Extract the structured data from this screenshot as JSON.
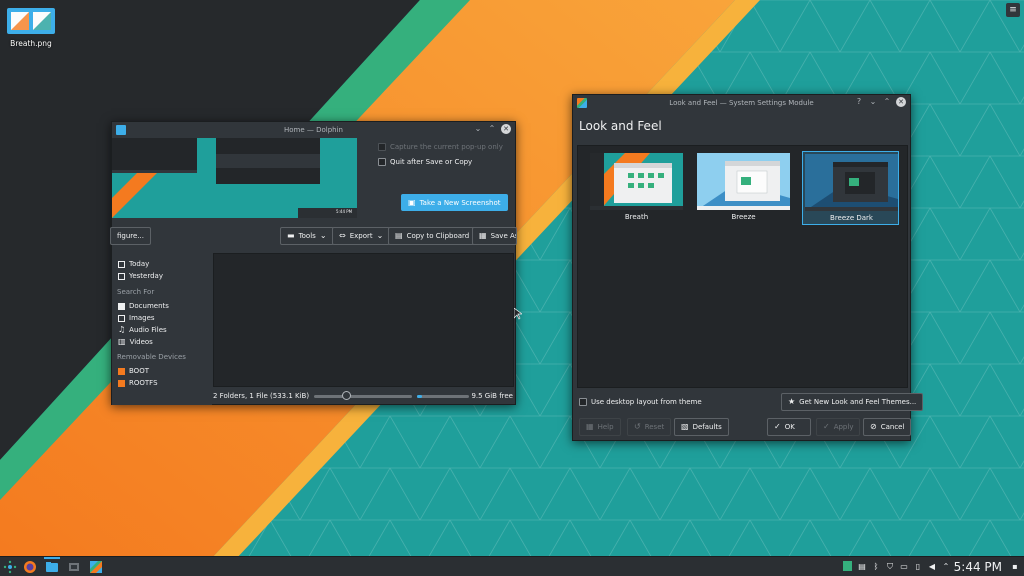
{
  "desktop": {
    "icon_label": "Breath.png",
    "toolbox_icon": "hamburger-icon"
  },
  "dolphin": {
    "title": "Home — Dolphin",
    "capture_popup_label": "Capture the current pop-up only",
    "quit_after_save_label": "Quit after Save or Copy",
    "take_screenshot_label": "Take a New Screenshot",
    "configure_label": "figure...",
    "tools_label": "Tools",
    "export_label": "Export",
    "copy_clipboard_label": "Copy to Clipboard",
    "save_as_label": "Save As",
    "sidebar": {
      "today": "Today",
      "yesterday": "Yesterday",
      "search_for": "Search For",
      "documents": "Documents",
      "images": "Images",
      "audio_files": "Audio Files",
      "videos": "Videos",
      "removable_devices": "Removable Devices",
      "boot": "BOOT",
      "rootfs": "ROOTFS"
    },
    "status_text": "2 Folders, 1 File (533.1 KiB)",
    "free_space": "9.5 GiB free",
    "preview_time": "5:44 PM",
    "zoom_level": 0.33,
    "free_space_fraction": 0.1
  },
  "lnf": {
    "window_title": "Look and Feel — System Settings Module",
    "heading": "Look and Feel",
    "themes": [
      {
        "name": "Breath"
      },
      {
        "name": "Breeze"
      },
      {
        "name": "Breeze Dark"
      }
    ],
    "selected_theme": "Breeze Dark",
    "use_layout_label": "Use desktop layout from theme",
    "get_new_label": "Get New Look and Feel Themes...",
    "help_label": "Help",
    "reset_label": "Reset",
    "defaults_label": "Defaults",
    "ok_label": "OK",
    "apply_label": "Apply",
    "cancel_label": "Cancel"
  },
  "panel": {
    "clock": "5:44 PM",
    "accent_color": "#3daee9"
  }
}
